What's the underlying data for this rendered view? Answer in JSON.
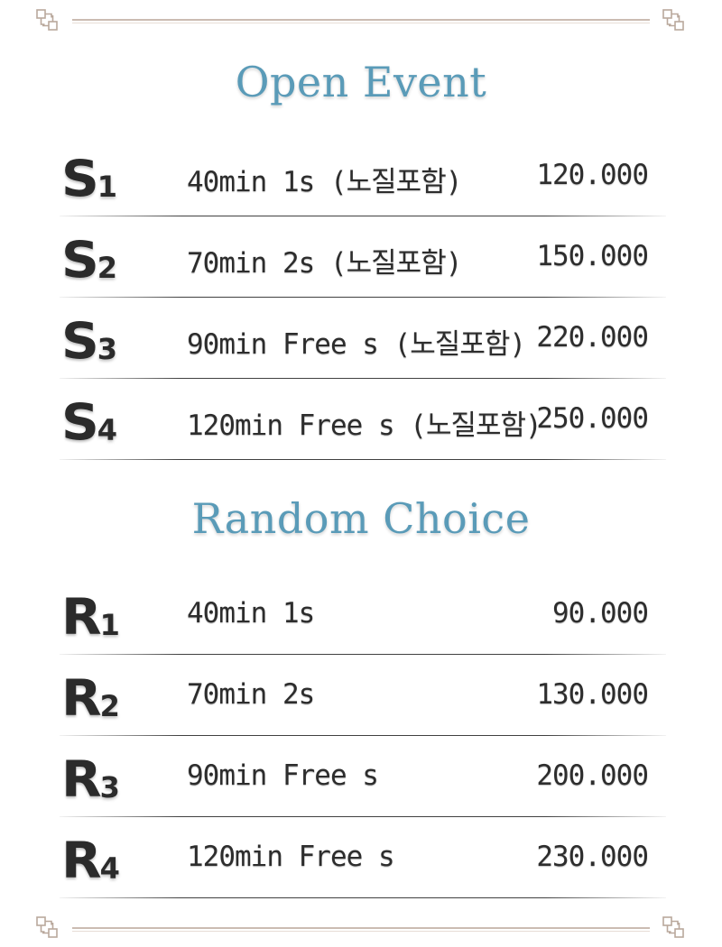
{
  "sections": [
    {
      "title": "Open Event",
      "rows": [
        {
          "code_letter": "S",
          "code_num": "1",
          "desc": "40min 1s (노질포함)",
          "price": "120.000"
        },
        {
          "code_letter": "S",
          "code_num": "2",
          "desc": "70min 2s (노질포함)",
          "price": "150.000"
        },
        {
          "code_letter": "S",
          "code_num": "3",
          "desc": "90min Free s (노질포함)",
          "price": "220.000"
        },
        {
          "code_letter": "S",
          "code_num": "4",
          "desc": "120min Free s (노질포함)",
          "price": "250.000"
        }
      ]
    },
    {
      "title": "Random Choice",
      "rows": [
        {
          "code_letter": "R",
          "code_num": "1",
          "desc": "40min 1s",
          "price": "90.000"
        },
        {
          "code_letter": "R",
          "code_num": "2",
          "desc": "70min 2s",
          "price": "130.000"
        },
        {
          "code_letter": "R",
          "code_num": "3",
          "desc": "90min Free s",
          "price": "200.000"
        },
        {
          "code_letter": "R",
          "code_num": "4",
          "desc": "120min Free s",
          "price": "230.000"
        }
      ]
    }
  ],
  "colors": {
    "title": "#5a9bb8",
    "text": "#2d2d2d",
    "frame": "#cbbcb2"
  },
  "icons": {
    "corner": "ornament-corner-icon"
  }
}
